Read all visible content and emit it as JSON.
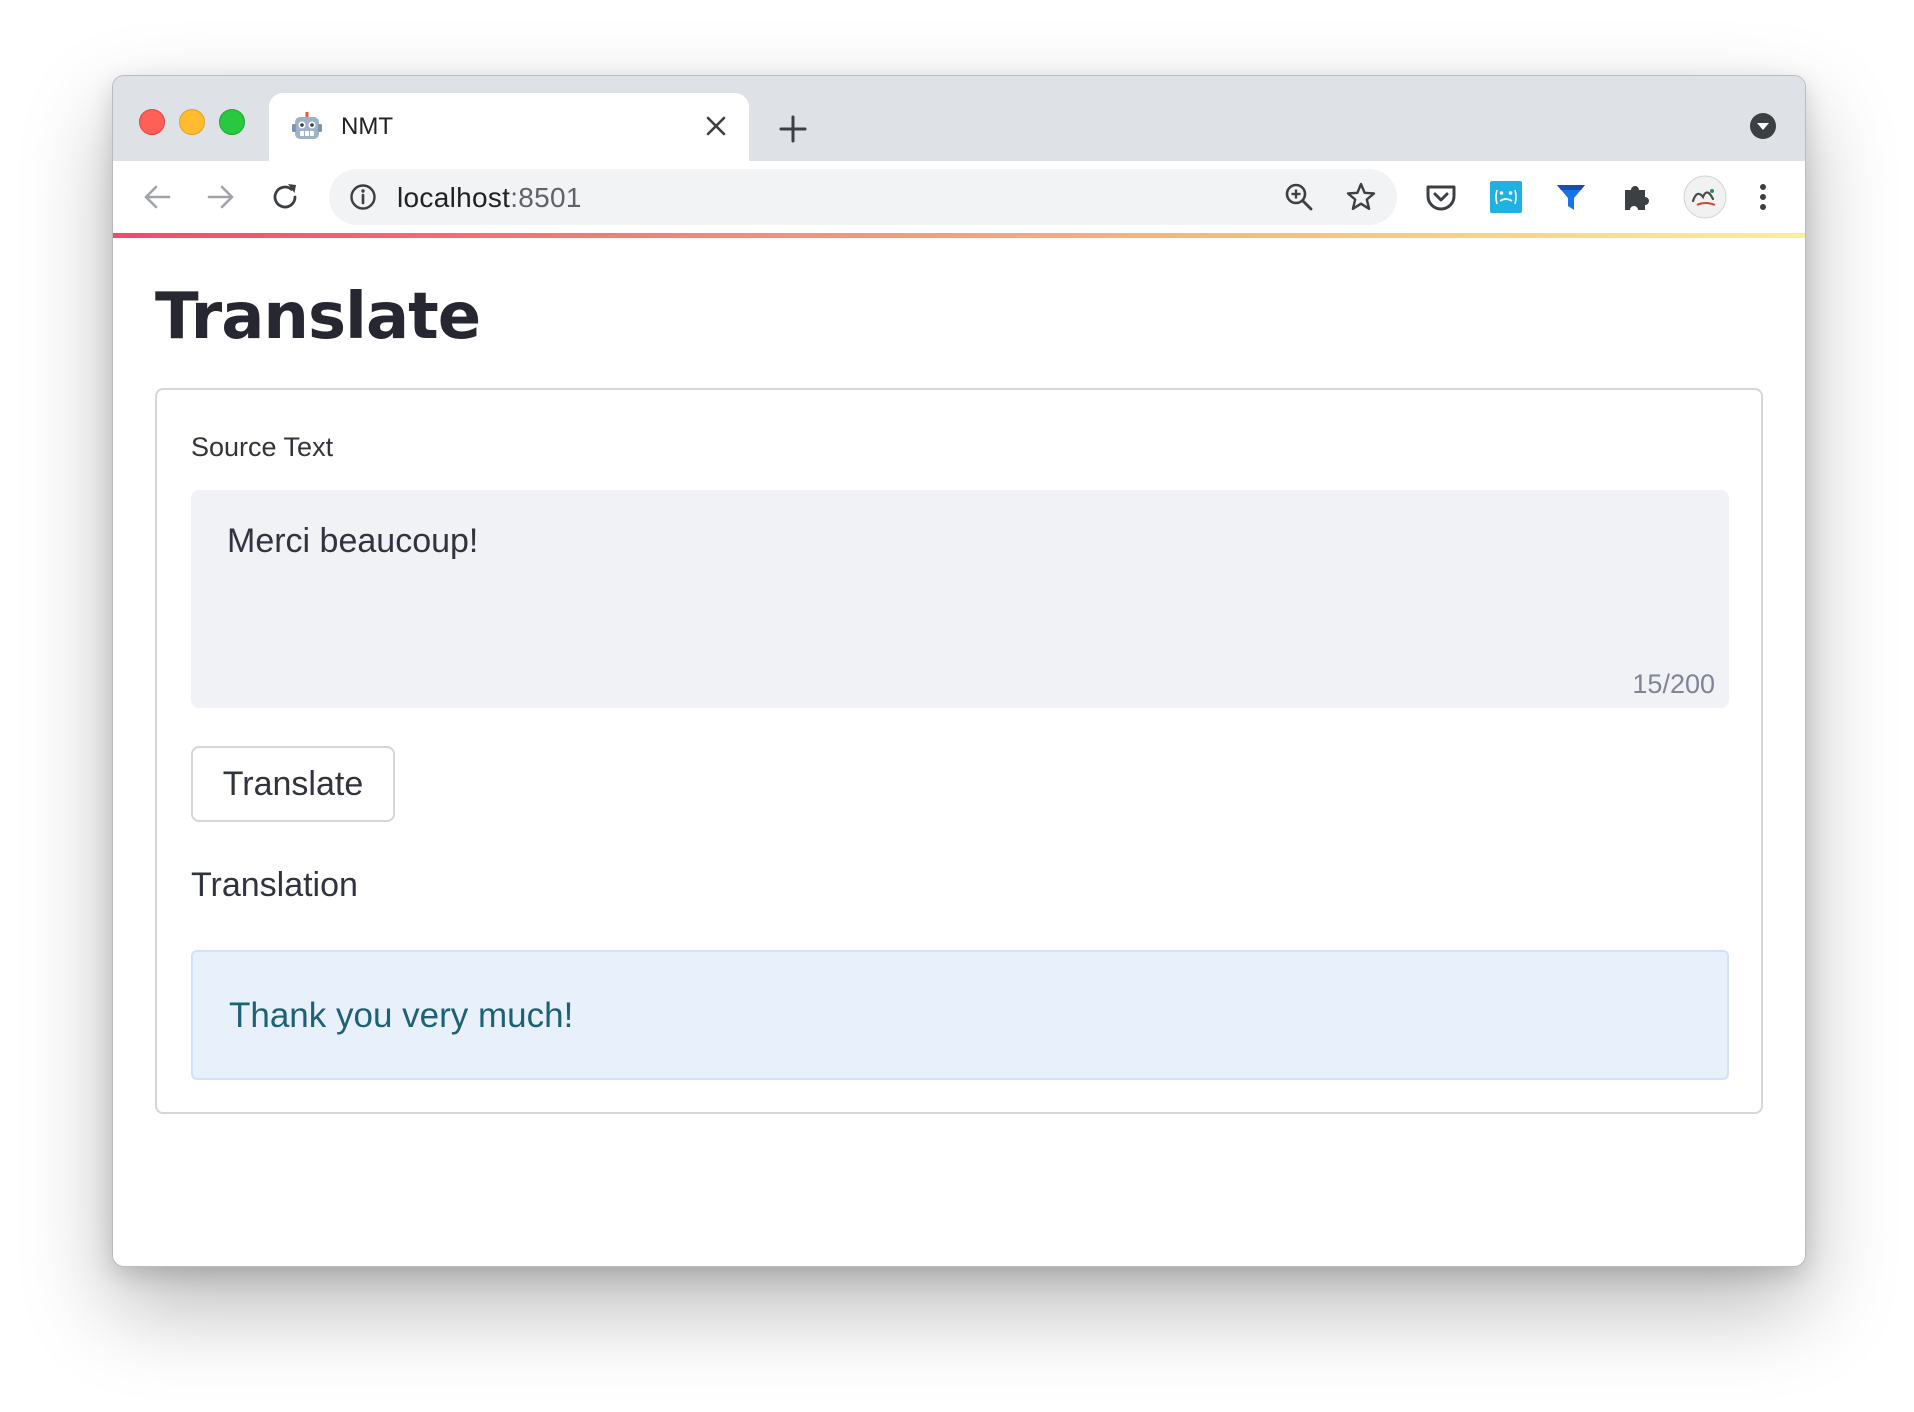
{
  "browser": {
    "tab": {
      "title": "NMT",
      "favicon": "robot-face-icon"
    },
    "omnibox": {
      "host": "localhost",
      "port": ":8501"
    },
    "accent_gradient": [
      "#ee4b6d",
      "#f2927a",
      "#f6c985",
      "#f9f09a"
    ]
  },
  "page": {
    "title": "Translate",
    "form": {
      "source_label": "Source Text",
      "source_value": "Merci beaucoup!",
      "char_count": "15/200",
      "button_label": "Translate",
      "translation_label": "Translation",
      "translation_value": "Thank you very much!"
    }
  },
  "colors": {
    "title_text": "#262730",
    "textarea_bg": "#f0f2f6",
    "result_bg": "#e8f0fb",
    "result_text": "#1d6174"
  }
}
